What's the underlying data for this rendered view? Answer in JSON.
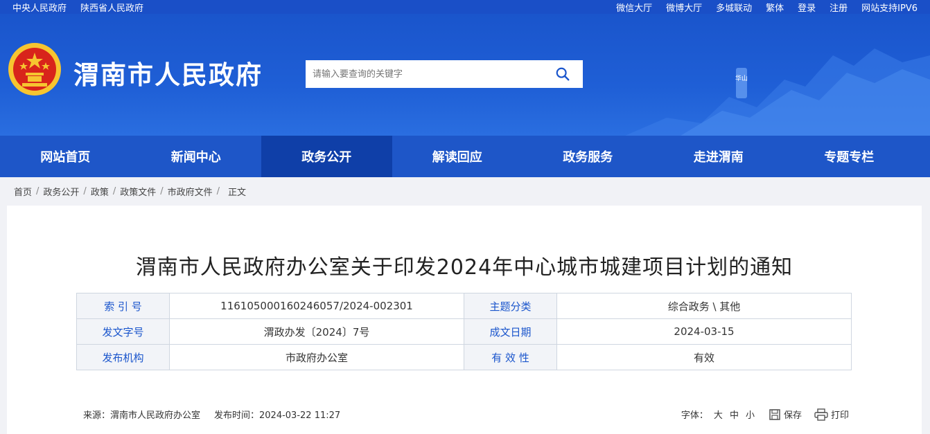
{
  "topbar": {
    "left_links": [
      "中央人民政府",
      "陕西省人民政府"
    ],
    "right_links": [
      "微信大厅",
      "微博大厅",
      "多城联动",
      "繁体",
      "登录",
      "注册",
      "网站支持IPV6"
    ]
  },
  "header": {
    "site_title": "渭南市人民政府",
    "search_placeholder": "请输入要查询的关键字",
    "mountain_text": "华山"
  },
  "nav": {
    "items": [
      "网站首页",
      "新闻中心",
      "政务公开",
      "解读回应",
      "政务服务",
      "走进渭南",
      "专题专栏"
    ],
    "active": "政务公开"
  },
  "breadcrumb": [
    "首页",
    "政务公开",
    "政策",
    "政策文件",
    "市政府文件",
    "正文"
  ],
  "article": {
    "title": "渭南市人民政府办公室关于印发2024年中心城市城建项目计划的通知",
    "meta": {
      "index_label": "索 引 号",
      "index_value": "116105000160246057/2024-002301",
      "topic_label": "主题分类",
      "topic_value": "综合政务 \\ 其他",
      "doc_no_label": "发文字号",
      "doc_no_value": "渭政办发〔2024〕7号",
      "date_label": "成文日期",
      "date_value": "2024-03-15",
      "publisher_label": "发布机构",
      "publisher_value": "市政府办公室",
      "validity_label": "有 效 性",
      "validity_value": "有效"
    },
    "source": "来源：渭南市人民政府办公室",
    "publish_time": "发布时间：2024-03-22 11:27",
    "font_label": "字体：",
    "font_large": "大",
    "font_medium": "中",
    "font_small": "小",
    "save_label": "保存",
    "print_label": "打印"
  },
  "colors": {
    "primary": "#1a55cc",
    "nav_active": "#0f3fa8",
    "emblem_red": "#d8241b",
    "emblem_gold": "#f6c530"
  }
}
